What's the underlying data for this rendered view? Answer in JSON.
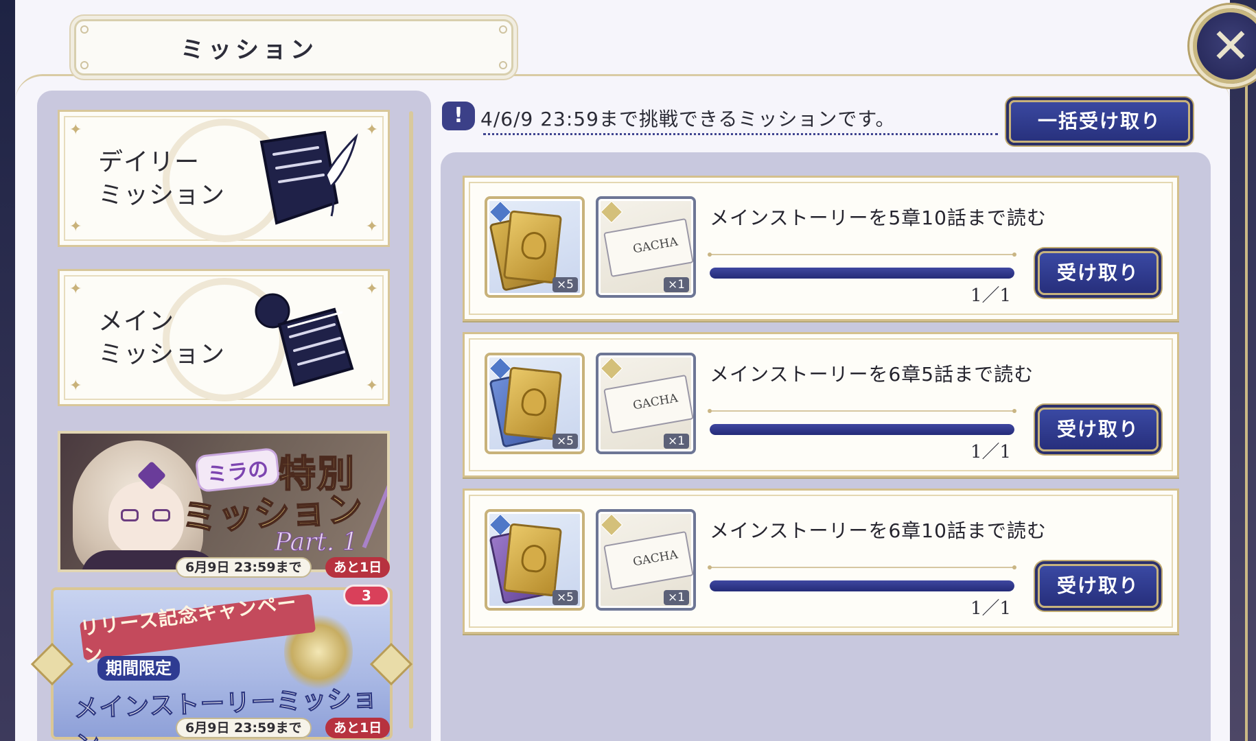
{
  "window": {
    "title": "ミッション"
  },
  "close_icon": "close-icon",
  "categories": [
    {
      "label_line1": "デイリー",
      "label_line2": "ミッション",
      "icon": "scroll-quill-icon"
    },
    {
      "label_line1": "メイン",
      "label_line2": "ミッション",
      "icon": "stacked-papers-icon"
    }
  ],
  "event_banner": {
    "name_tag": "ミラの",
    "title_line1": "特別",
    "title_line2": "ミッション",
    "part": "Part. 1",
    "date": "6月9日 23:59まで",
    "remaining": "あと1日"
  },
  "campaign_banner": {
    "ribbon": "リリース記念キャンペーン",
    "limited": "期間限定",
    "title": "メインストーリーミッション",
    "badge": "3",
    "date": "6月9日 23:59まで",
    "remaining": "あと1日"
  },
  "notice": {
    "icon": "exclamation-icon",
    "text": "4/6/9 23:59まで挑戦できるミッションです。"
  },
  "claim_all_label": "一括受け取り",
  "missions": [
    {
      "title": "メインストーリーを5章10話まで読む",
      "progress_text": "1／1",
      "progress": 1.0,
      "rewards": [
        {
          "type": "book",
          "qty": "×5"
        },
        {
          "type": "gacha-ticket",
          "qty": "×1",
          "ticket_label": "GACHA"
        }
      ],
      "button": "受け取り"
    },
    {
      "title": "メインストーリーを6章5話まで読む",
      "progress_text": "1／1",
      "progress": 1.0,
      "rewards": [
        {
          "type": "book",
          "qty": "×5"
        },
        {
          "type": "gacha-ticket",
          "qty": "×1",
          "ticket_label": "GACHA"
        }
      ],
      "button": "受け取り"
    },
    {
      "title": "メインストーリーを6章10話まで読む",
      "progress_text": "1／1",
      "progress": 1.0,
      "rewards": [
        {
          "type": "book",
          "qty": "×5"
        },
        {
          "type": "gacha-ticket",
          "qty": "×1",
          "ticket_label": "GACHA"
        }
      ],
      "button": "受け取り"
    }
  ],
  "colors": {
    "accent_navy": "#2a3180",
    "gold_border": "#d4c08c",
    "panel_lavender": "#c8c8de",
    "badge_red": "#b7323f"
  }
}
